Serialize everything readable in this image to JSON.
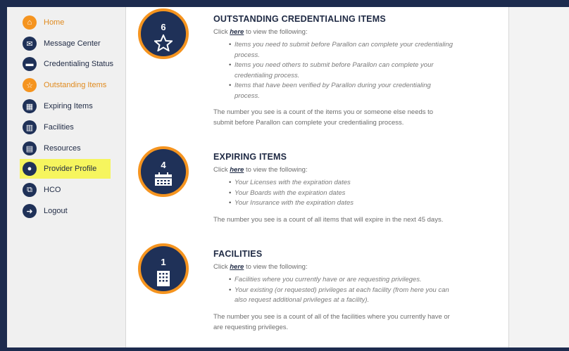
{
  "sidebar": {
    "items": [
      {
        "label": "Home",
        "icon": "home-icon",
        "glyph": "⌂",
        "style": "orange"
      },
      {
        "label": "Message Center",
        "icon": "envelope-icon",
        "glyph": "✉",
        "style": ""
      },
      {
        "label": "Credentialing Status",
        "icon": "folder-icon",
        "glyph": "▬",
        "style": ""
      },
      {
        "label": "Outstanding Items",
        "icon": "star-icon",
        "glyph": "☆",
        "style": "orange"
      },
      {
        "label": "Expiring Items",
        "icon": "calendar-icon",
        "glyph": "▦",
        "style": ""
      },
      {
        "label": "Facilities",
        "icon": "building-icon",
        "glyph": "▥",
        "style": ""
      },
      {
        "label": "Resources",
        "icon": "book-icon",
        "glyph": "▤",
        "style": ""
      },
      {
        "label": "Provider Profile",
        "icon": "user-icon",
        "glyph": "●",
        "style": "highlight"
      },
      {
        "label": "HCO",
        "icon": "hco-icon",
        "glyph": "⧉",
        "style": ""
      },
      {
        "label": "Logout",
        "icon": "logout-icon",
        "glyph": "➜",
        "style": ""
      }
    ]
  },
  "sections": {
    "outstanding": {
      "count": "6",
      "title": "OUTSTANDING CREDENTIALING ITEMS",
      "click_prefix": "Click ",
      "link": "here",
      "click_suffix": " to view the following:",
      "bullets": [
        "Items you need to submit before Parallon can complete your credentialing process.",
        "Items you need others to submit before Parallon can complete your credentialing process.",
        "Items that have been verified by Parallon during your credentialing process."
      ],
      "note": "The number you see is a count of the items you or someone else needs to submit before Parallon can complete your credentialing process."
    },
    "expiring": {
      "count": "4",
      "title": "EXPIRING ITEMS",
      "click_prefix": "Click ",
      "link": "here",
      "click_suffix": " to view the following:",
      "bullets": [
        "Your Licenses with the expiration dates",
        "Your Boards with the expiration dates",
        "Your Insurance with the expiration dates"
      ],
      "note": "The number you see is a count of all items that will expire in the next 45 days."
    },
    "facilities": {
      "count": "1",
      "title": "FACILITIES",
      "click_prefix": "Click ",
      "link": "here",
      "click_suffix": " to view the following:",
      "bullets": [
        "Facilities where you currently have or are requesting privileges.",
        "Your existing (or requested) privileges at each facility (from here you can also request additional privileges at a facility)."
      ],
      "note": "The number you see is a count of all of the facilities where you currently have or are requesting privileges."
    }
  },
  "colors": {
    "navy": "#1f3158",
    "orange": "#f5941f",
    "highlight": "#f6f55e",
    "frame": "#1d2b4e"
  }
}
